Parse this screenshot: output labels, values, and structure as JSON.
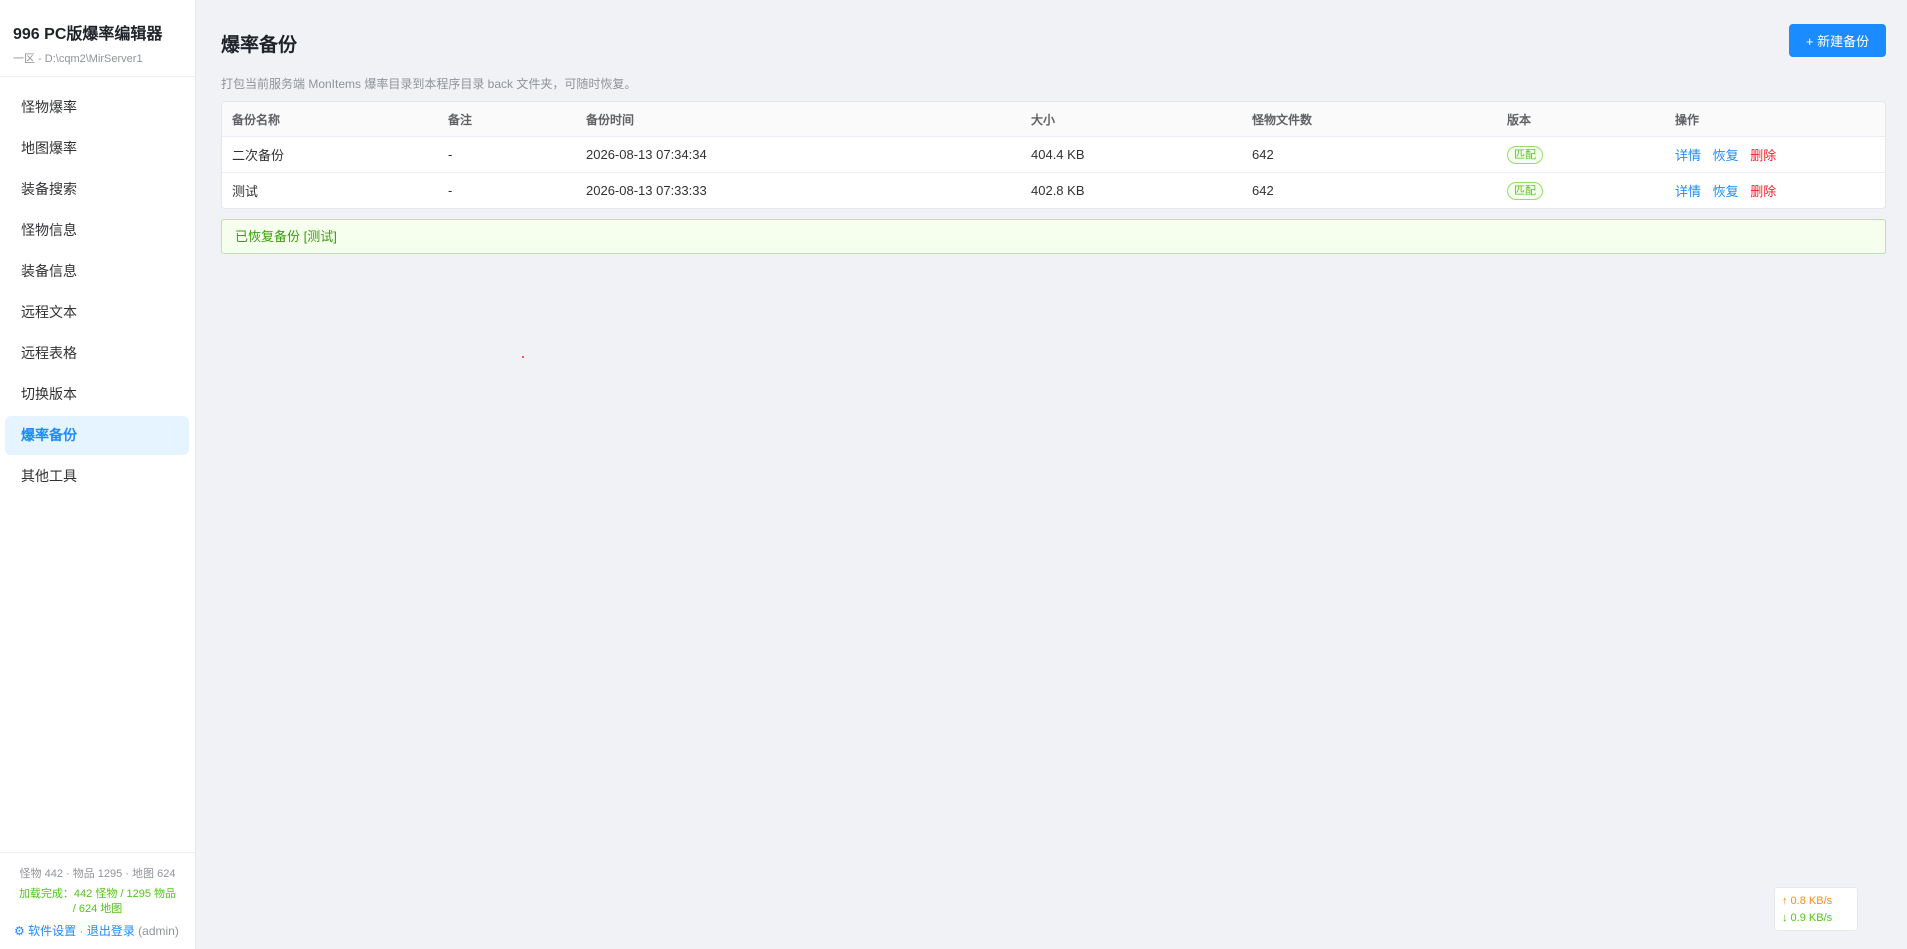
{
  "app": {
    "title": "996 PC版爆率编辑器",
    "path": "一区 - D:\\cqm2\\MirServer1"
  },
  "nav": [
    {
      "label": "怪物爆率"
    },
    {
      "label": "地图爆率"
    },
    {
      "label": "装备搜索"
    },
    {
      "label": "怪物信息"
    },
    {
      "label": "装备信息"
    },
    {
      "label": "远程文本"
    },
    {
      "label": "远程表格"
    },
    {
      "label": "切换版本"
    },
    {
      "label": "爆率备份"
    },
    {
      "label": "其他工具"
    }
  ],
  "sidebar_footer": {
    "stats": "怪物 442 · 物品 1295 · 地图 624",
    "loaded_line1": "加载完成：442 怪物 / 1295 物品",
    "loaded_line2": "/ 624 地图",
    "gear_icon": "⚙",
    "settings": "软件设置",
    "separator": "·",
    "logout": "退出登录",
    "user": "(admin)"
  },
  "page": {
    "title": "爆率备份",
    "new_button": "+ 新建备份",
    "description": "打包当前服务端 MonItems 爆率目录到本程序目录 back 文件夹，可随时恢复。"
  },
  "table": {
    "headers": [
      "备份名称",
      "备注",
      "备份时间",
      "大小",
      "怪物文件数",
      "版本",
      "操作"
    ],
    "rows": [
      {
        "name": "二次备份",
        "note": "-",
        "time": "2026-08-13 07:34:34",
        "size": "404.4 KB",
        "count": "642",
        "version": "匹配"
      },
      {
        "name": "测试",
        "note": "-",
        "time": "2026-08-13 07:33:33",
        "size": "402.8 KB",
        "count": "642",
        "version": "匹配"
      }
    ],
    "actions": {
      "detail": "详情",
      "restore": "恢复",
      "delete": "删除"
    }
  },
  "notice": "已恢复备份 [测试]",
  "speed": {
    "up": "↑ 0.8 KB/s",
    "down": "↓ 0.9 KB/s"
  },
  "colors": {
    "accent": "#1a8cff",
    "success": "#52c41a",
    "danger": "#f5222d"
  }
}
